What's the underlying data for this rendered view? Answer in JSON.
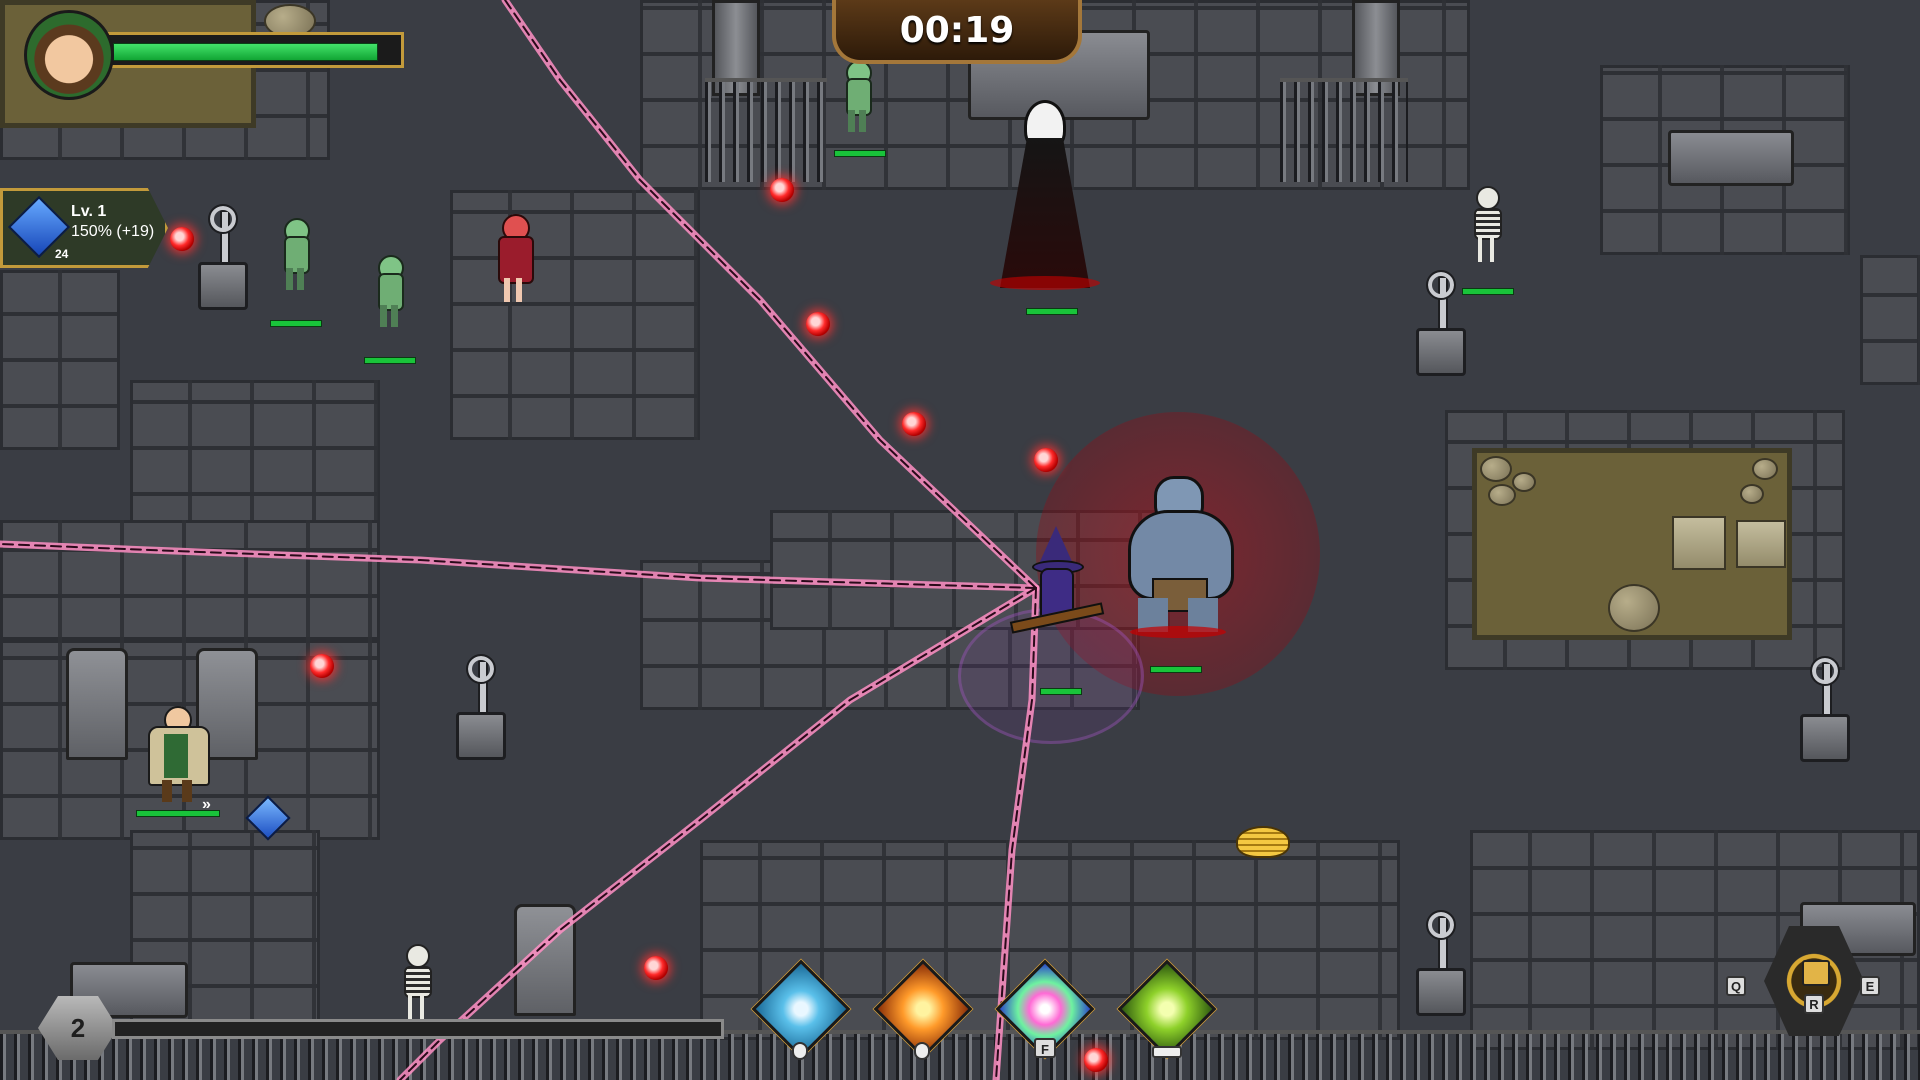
{
  "hud": {
    "timer": "00:19",
    "player_health_fraction": 0.94,
    "level_panel": {
      "level": "Lv. 1",
      "stat": "150% (+19)",
      "count": "24"
    },
    "xp": {
      "level": "2",
      "fraction": 0.0
    }
  },
  "skills": [
    {
      "icon": "whirlwind-skill-icon",
      "key": ""
    },
    {
      "icon": "fire-burst-skill-icon",
      "key": ""
    },
    {
      "icon": "rainbow-orb-skill-icon",
      "key": "F"
    },
    {
      "icon": "dash-skill-icon",
      "key": ""
    }
  ],
  "weapon_wheel": {
    "key_left": "Q",
    "key_right": "E",
    "key_center": "R"
  },
  "colors": {
    "accent_gold": "#c29a3b",
    "health_green": "#19c43a",
    "lightning": "#ff6fae"
  }
}
